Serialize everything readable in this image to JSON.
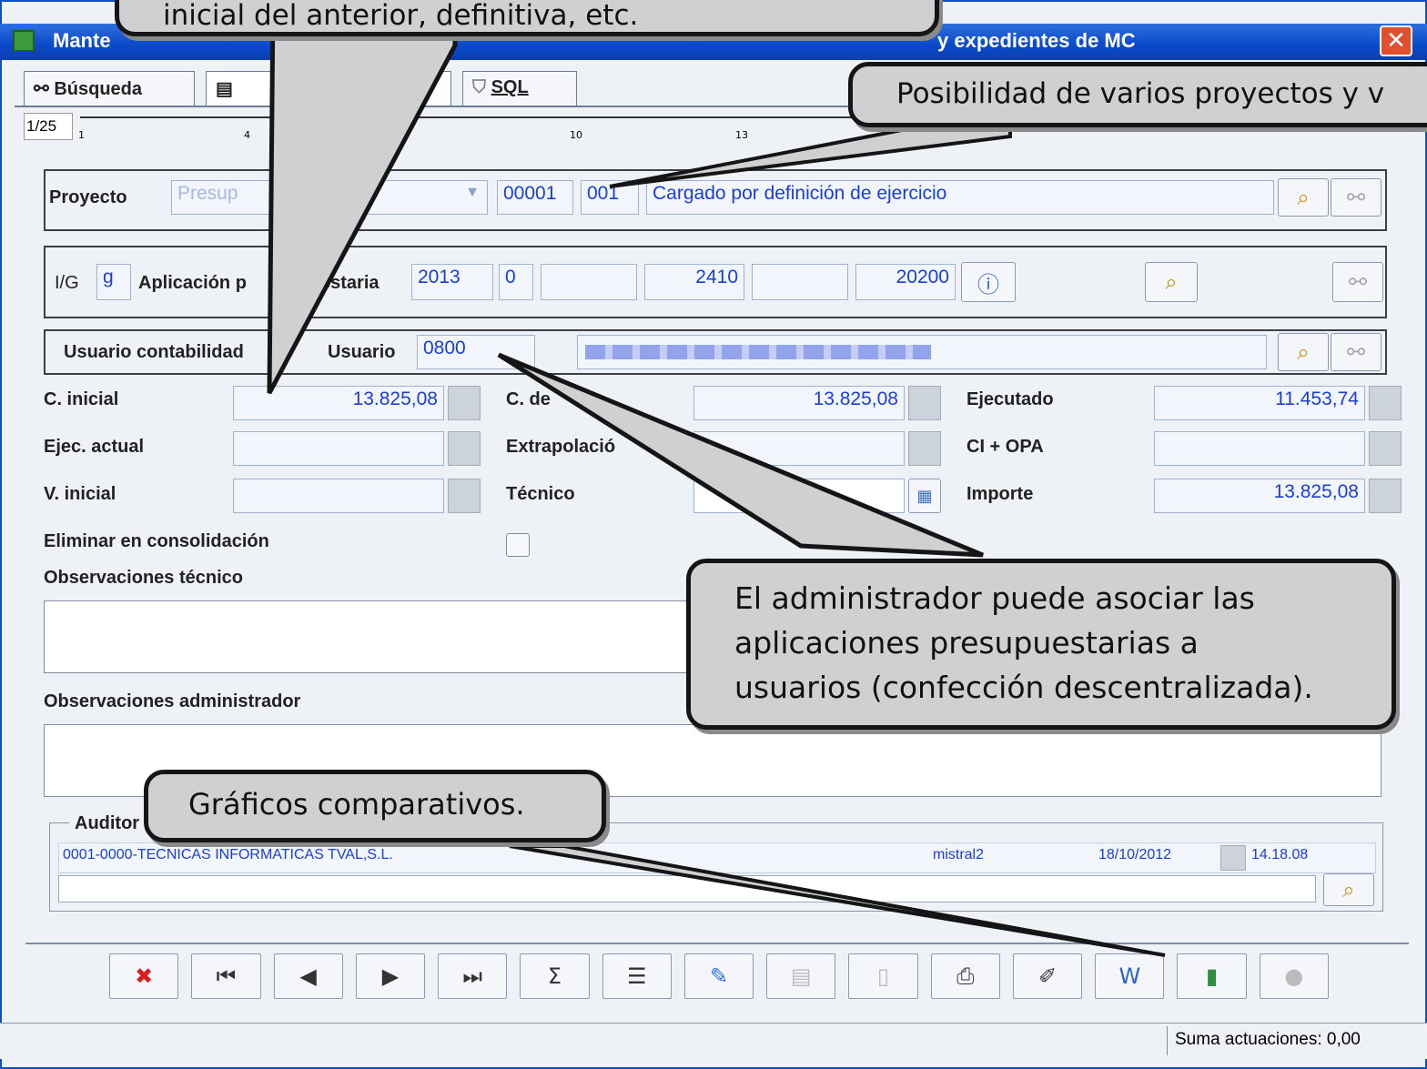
{
  "window": {
    "title_left": "Mante",
    "title_right": "y expedientes de MC",
    "close_icon": "close-icon"
  },
  "tabs": [
    {
      "label": "Búsqueda",
      "icon": "binoculars-icon"
    },
    {
      "label": "",
      "icon": "form-icon"
    },
    {
      "label": "SQL",
      "icon": "filter-icon"
    }
  ],
  "ruler": {
    "page": "1/25",
    "tick_1": "1",
    "tick_4": "4",
    "tick_10": "10",
    "tick_13": "13"
  },
  "proyecto": {
    "label": "Proyecto",
    "select_value": "Presup",
    "code1": "00001",
    "code2": "001",
    "description": "Cargado por definición de ejercicio"
  },
  "aplicacion": {
    "ig_label": "I/G",
    "ig_value": "g",
    "label_start": "Aplicación p",
    "label_end": "estaria",
    "year": "2013",
    "f1": "0",
    "f2": "",
    "f3": "2410",
    "f4": "",
    "f5": "20200"
  },
  "usuario": {
    "contabilidad_label": "Usuario contabilidad",
    "usuario_label": "Usuario",
    "usuario_value": "0800"
  },
  "fields": {
    "c_inicial_label": "C. inicial",
    "c_inicial_value": "13.825,08",
    "c_def_label": "C. de",
    "c_def_value": "13.825,08",
    "ejecutado_label": "Ejecutado",
    "ejecutado_value": "11.453,74",
    "ejec_actual_label": "Ejec. actual",
    "ejec_actual_value": "",
    "extrapolacion_label": "Extrapolació",
    "extrapolacion_value": "",
    "ci_opa_label": "CI + OPA",
    "ci_opa_value": "",
    "v_inicial_label": "V. inicial",
    "v_inicial_value": "",
    "tecnico_label": "Técnico",
    "tecnico_value": "",
    "importe_label": "Importe",
    "importe_value": "13.825,08",
    "eliminar_label": "Eliminar en consolidación",
    "obs_tecnico_label": "Observaciones técnico",
    "obs_admin_label": "Observaciones administrador"
  },
  "auditoria": {
    "label": "Auditor",
    "entity": "0001-0000-TECNICAS INFORMATICAS TVAL,S.L.",
    "user": "mistral2",
    "date": "18/10/2012",
    "time": "14.18.08"
  },
  "toolbar": [
    {
      "name": "delete-button",
      "icon": "✖"
    },
    {
      "name": "first-button",
      "icon": "⏮"
    },
    {
      "name": "prev-button",
      "icon": "◀"
    },
    {
      "name": "next-button",
      "icon": "▶"
    },
    {
      "name": "last-button",
      "icon": "⏭"
    },
    {
      "name": "sum-button",
      "icon": "Σ"
    },
    {
      "name": "list-button",
      "icon": "☰"
    },
    {
      "name": "edit-button",
      "icon": "✎"
    },
    {
      "name": "db-button",
      "icon": "▤"
    },
    {
      "name": "doc-button",
      "icon": "▯"
    },
    {
      "name": "print-button",
      "icon": "⎙"
    },
    {
      "name": "attach-button",
      "icon": "✐"
    },
    {
      "name": "word-button",
      "icon": "W"
    },
    {
      "name": "chart-button",
      "icon": "▮"
    },
    {
      "name": "user-button",
      "icon": "●"
    }
  ],
  "status": {
    "text": "Suma actuaciones: 0,00"
  },
  "callouts": {
    "top": "inicial del anterior, definitiva, etc.",
    "right": "Posibilidad de varios proyectos y v",
    "middle_line1": "El administrador puede asociar las",
    "middle_line2": "aplicaciones presupuestarias a",
    "middle_line3": "usuarios (confección descentralizada).",
    "graphs": "Gráficos comparativos."
  }
}
